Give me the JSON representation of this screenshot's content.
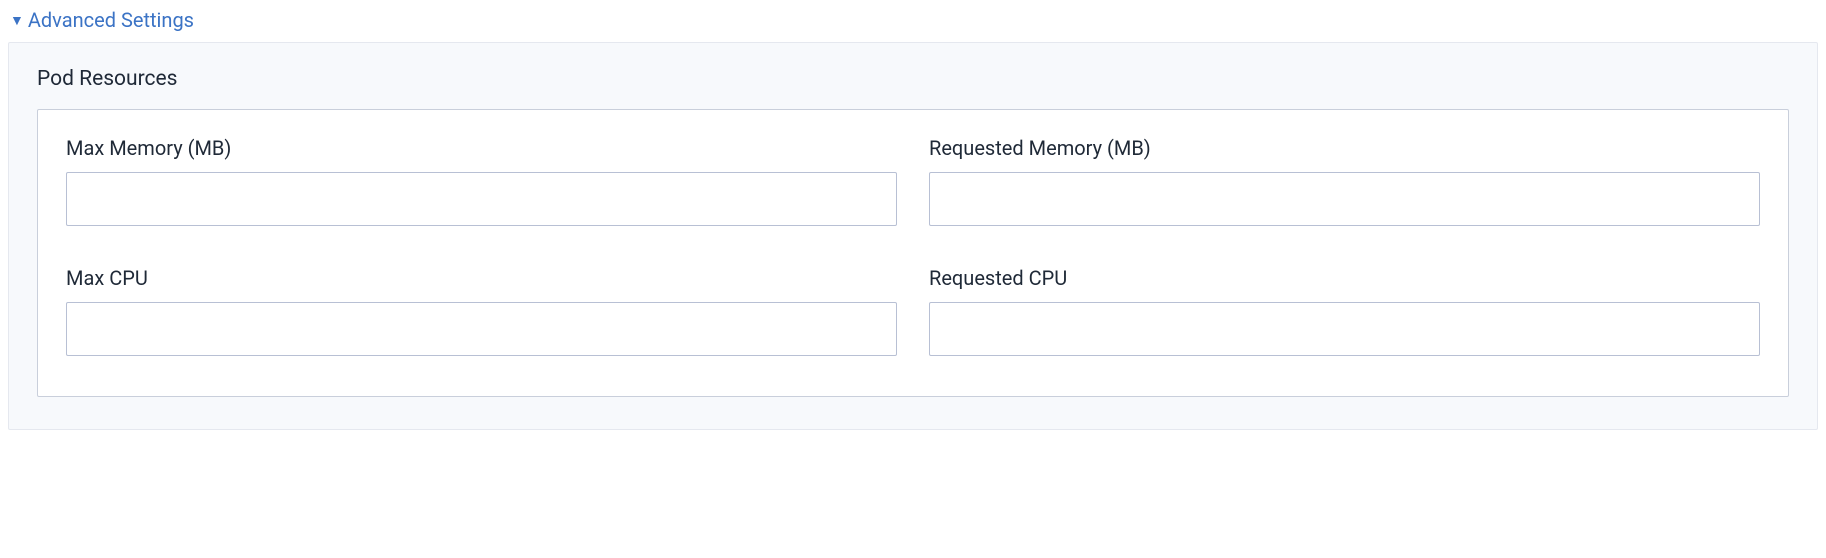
{
  "toggle": {
    "label": "Advanced Settings",
    "expanded": true
  },
  "section": {
    "title": "Pod Resources",
    "fields": {
      "maxMemory": {
        "label": "Max Memory (MB)",
        "value": ""
      },
      "requestedMemory": {
        "label": "Requested Memory (MB)",
        "value": ""
      },
      "maxCpu": {
        "label": "Max CPU",
        "value": ""
      },
      "requestedCpu": {
        "label": "Requested CPU",
        "value": ""
      }
    }
  }
}
